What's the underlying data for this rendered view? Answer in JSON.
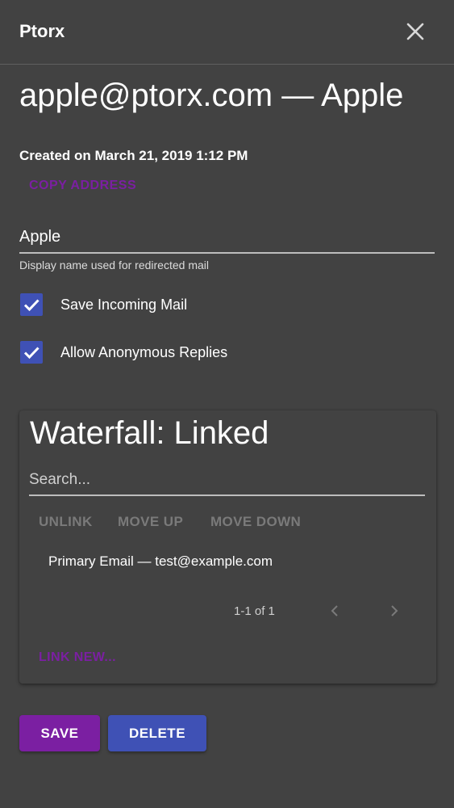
{
  "app": {
    "title": "Ptorx",
    "close_icon": "close-icon"
  },
  "header": {
    "title": "apple@ptorx.com — Apple",
    "created": "Created on March 21, 2019 1:12 PM",
    "copy_address_label": "Copy Address"
  },
  "display_name": {
    "value": "Apple",
    "helper": "Display name used for redirected mail"
  },
  "options": [
    {
      "label": "Save Incoming Mail",
      "checked": true
    },
    {
      "label": "Allow Anonymous Replies",
      "checked": true
    }
  ],
  "waterfall": {
    "title": "Waterfall: Linked",
    "search_placeholder": "Search...",
    "actions": [
      "Unlink",
      "Move Up",
      "Move Down"
    ],
    "items": [
      "Primary Email — test@example.com"
    ],
    "pagination": "1-1 of 1",
    "prev_icon": "chevron-left-icon",
    "next_icon": "chevron-right-icon",
    "link_new_label": "Link New..."
  },
  "footer": {
    "save_label": "Save",
    "delete_label": "Delete"
  },
  "colors": {
    "background": "#424242",
    "primary": "#7b1fa2",
    "secondary": "#3f51b5",
    "disabled": "#7a7a7a"
  }
}
